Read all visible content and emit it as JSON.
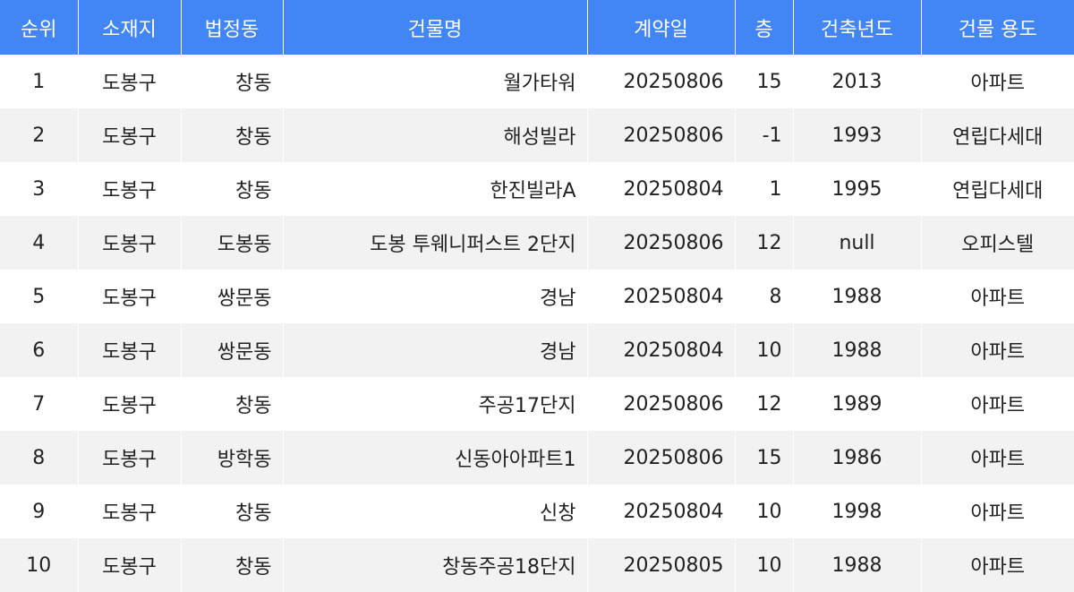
{
  "table": {
    "header_bg": "#4285f4",
    "stripe_bg": "#f2f2f2",
    "columns": [
      "순위",
      "소재지",
      "법정동",
      "건물명",
      "계약일",
      "층",
      "건축년도",
      "건물 용도"
    ],
    "rows": [
      [
        "1",
        "도봉구",
        "창동",
        "월가타워",
        "20250806",
        "15",
        "2013",
        "아파트"
      ],
      [
        "2",
        "도봉구",
        "창동",
        "해성빌라",
        "20250806",
        "-1",
        "1993",
        "연립다세대"
      ],
      [
        "3",
        "도봉구",
        "창동",
        "한진빌라A",
        "20250804",
        "1",
        "1995",
        "연립다세대"
      ],
      [
        "4",
        "도봉구",
        "도봉동",
        "도봉 투웨니퍼스트 2단지",
        "20250806",
        "12",
        "null",
        "오피스텔"
      ],
      [
        "5",
        "도봉구",
        "쌍문동",
        "경남",
        "20250804",
        "8",
        "1988",
        "아파트"
      ],
      [
        "6",
        "도봉구",
        "쌍문동",
        "경남",
        "20250804",
        "10",
        "1988",
        "아파트"
      ],
      [
        "7",
        "도봉구",
        "창동",
        "주공17단지",
        "20250806",
        "12",
        "1989",
        "아파트"
      ],
      [
        "8",
        "도봉구",
        "방학동",
        "신동아아파트1",
        "20250806",
        "15",
        "1986",
        "아파트"
      ],
      [
        "9",
        "도봉구",
        "창동",
        "신창",
        "20250804",
        "10",
        "1998",
        "아파트"
      ],
      [
        "10",
        "도봉구",
        "창동",
        "창동주공18단지",
        "20250805",
        "10",
        "1988",
        "아파트"
      ]
    ]
  }
}
